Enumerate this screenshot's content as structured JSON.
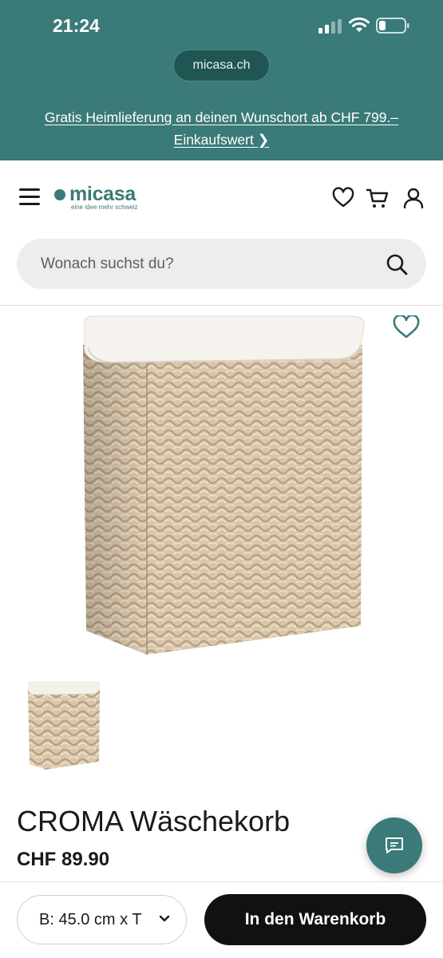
{
  "status_bar": {
    "time": "21:24"
  },
  "browser": {
    "url": "micasa.ch"
  },
  "promo": {
    "line1": "Gratis Heimlieferung an deinen Wunschort ab CHF 799.–",
    "line2": "Einkaufswert ❯"
  },
  "header": {
    "logo_text": "micasa",
    "logo_tagline": "eine idee mehr schweiz"
  },
  "search": {
    "placeholder": "Wonach suchst du?"
  },
  "product": {
    "title": "CROMA Wäschekorb",
    "price": "CHF 89.90"
  },
  "bottom_bar": {
    "size_value": "B: 45.0 cm x T",
    "add_to_cart": "In den Warenkorb"
  },
  "colors": {
    "brand_teal": "#3a7a78",
    "button_black": "#111111"
  }
}
